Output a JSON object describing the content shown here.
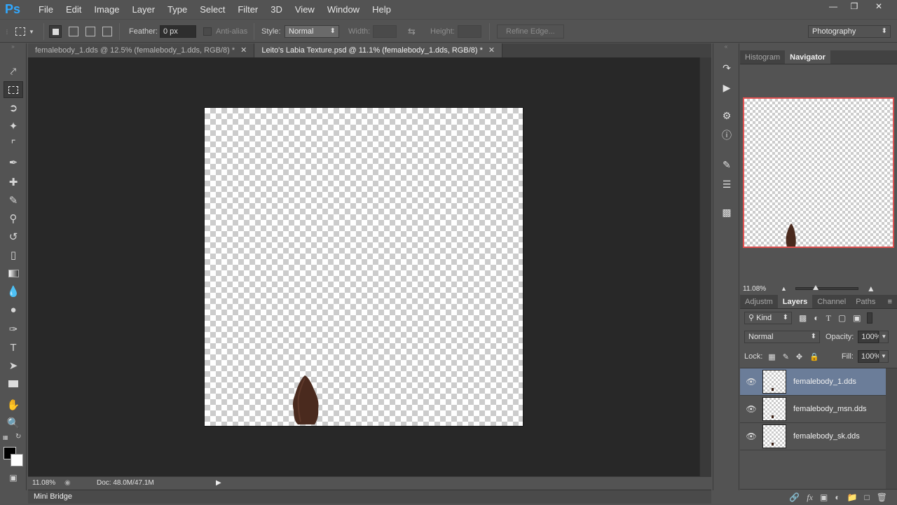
{
  "app": {
    "logo": "Ps"
  },
  "menu": [
    "File",
    "Edit",
    "Image",
    "Layer",
    "Type",
    "Select",
    "Filter",
    "3D",
    "View",
    "Window",
    "Help"
  ],
  "window_controls": {
    "minimize": "—",
    "restore": "❐",
    "close": "✕"
  },
  "options": {
    "feather_label": "Feather:",
    "feather_value": "0 px",
    "antialias_label": "Anti-alias",
    "style_label": "Style:",
    "style_value": "Normal",
    "width_label": "Width:",
    "height_label": "Height:",
    "refine_edge": "Refine Edge...",
    "workspace": "Photography"
  },
  "tabs": [
    {
      "label": "femalebody_1.dds @ 12.5% (femalebody_1.dds, RGB/8) *",
      "active": false
    },
    {
      "label": "Leito's Labia Texture.psd @ 11.1% (femalebody_1.dds, RGB/8) *",
      "active": true
    }
  ],
  "status": {
    "zoom": "11.08%",
    "doc": "Doc: 48.0M/47.1M"
  },
  "mini_bridge": "Mini Bridge",
  "navigator": {
    "tab_histogram": "Histogram",
    "tab_navigator": "Navigator",
    "zoom": "11.08%"
  },
  "layers_panel": {
    "tabs": [
      "Adjustm",
      "Layers",
      "Channel",
      "Paths"
    ],
    "kind_label": "Kind",
    "blend_mode": "Normal",
    "opacity_label": "Opacity:",
    "opacity_value": "100%",
    "lock_label": "Lock:",
    "fill_label": "Fill:",
    "fill_value": "100%",
    "layers": [
      {
        "name": "femalebody_1.dds",
        "selected": true
      },
      {
        "name": "femalebody_msn.dds",
        "selected": false
      },
      {
        "name": "femalebody_sk.dds",
        "selected": false
      }
    ]
  },
  "colors": {
    "accent": "#31a8ff",
    "selected_layer": "#6b7d99",
    "nav_frame": "#e05252",
    "shape": "#4a2a1e"
  }
}
